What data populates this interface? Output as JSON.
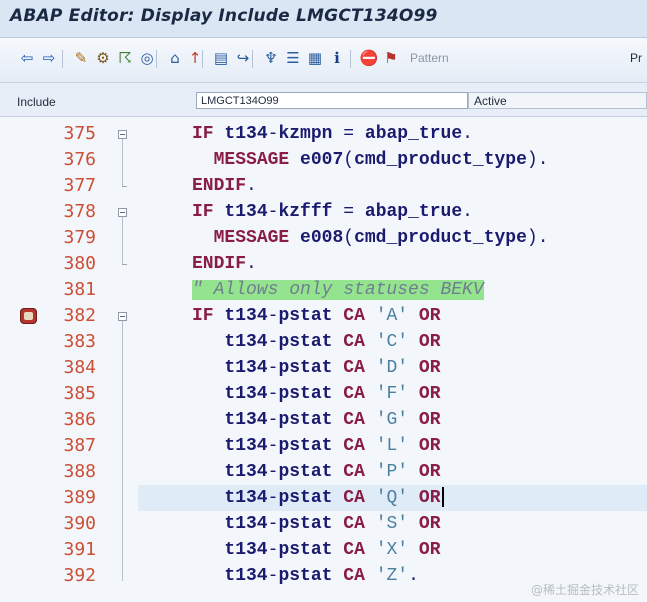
{
  "window": {
    "title": "ABAP Editor: Display Include LMGCT134O99"
  },
  "toolbar": {
    "buttons": [
      {
        "name": "back-arrow-icon",
        "glyph": "⇦",
        "color": "#1b58b7"
      },
      {
        "name": "forward-arrow-icon",
        "glyph": "⇨",
        "color": "#1b58b7"
      },
      {
        "name": "other-object-icon",
        "glyph": "✎",
        "color": "#a86e1f"
      },
      {
        "name": "toggle-display-change-icon",
        "glyph": "⚙",
        "color": "#7a5a1f"
      },
      {
        "name": "activate-icon",
        "glyph": "☈",
        "color": "#3d7f2f"
      },
      {
        "name": "where-used-icon",
        "glyph": "◎",
        "color": "#2b5c9e"
      },
      {
        "name": "object-list-icon",
        "glyph": "⌂",
        "color": "#2b5c9e"
      },
      {
        "name": "display-object-list-icon",
        "glyph": "↑",
        "color": "#c43d2b"
      },
      {
        "name": "navigation-window-icon",
        "glyph": "▤",
        "color": "#2b5c9e"
      },
      {
        "name": "enhance-icon",
        "glyph": "↪",
        "color": "#2b5c9e"
      },
      {
        "name": "hierarchy-icon",
        "glyph": "♆",
        "color": "#2b5c9e"
      },
      {
        "name": "tree-icon",
        "glyph": "☰",
        "color": "#2b5c9e"
      },
      {
        "name": "module-icon",
        "glyph": "▦",
        "color": "#2b5c9e"
      },
      {
        "name": "info-icon",
        "glyph": "ℹ",
        "color": "#1c3c8a"
      },
      {
        "name": "set-breakpoint-icon",
        "glyph": "⛔",
        "color": "#b8332b"
      },
      {
        "name": "session-breakpoint-icon",
        "glyph": "⚑",
        "color": "#b8332b"
      }
    ],
    "pattern_label": "Pattern",
    "pretty_label": "Pr"
  },
  "include_bar": {
    "label": "Include",
    "name_value": "LMGCT134O99",
    "status": "Active"
  },
  "editor": {
    "breakpoint_line": "382",
    "current_line": "389",
    "lines": [
      {
        "num": "375",
        "fold": "box",
        "html": "<span class=\"kw\">IF</span> <span class=\"ident\">t134</span><span class=\"op\">-</span><span class=\"ident\">kzmpn</span> <span class=\"op\">=</span> <span class=\"ident\">abap_true</span><span class=\"op\">.</span>"
      },
      {
        "num": "376",
        "fold": "line",
        "html": "  <span class=\"kw\">MESSAGE</span> <span class=\"ident\">e007</span><span class=\"op\">(</span><span class=\"ident\">cmd_product_type</span><span class=\"op\">).</span>"
      },
      {
        "num": "377",
        "fold": "tick",
        "html": "<span class=\"kw\">ENDIF</span><span class=\"op\">.</span>"
      },
      {
        "num": "378",
        "fold": "box",
        "html": "<span class=\"kw\">IF</span> <span class=\"ident\">t134</span><span class=\"op\">-</span><span class=\"ident\">kzfff</span> <span class=\"op\">=</span> <span class=\"ident\">abap_true</span><span class=\"op\">.</span>"
      },
      {
        "num": "379",
        "fold": "line",
        "html": "  <span class=\"kw\">MESSAGE</span> <span class=\"ident\">e008</span><span class=\"op\">(</span><span class=\"ident\">cmd_product_type</span><span class=\"op\">).</span>"
      },
      {
        "num": "380",
        "fold": "tick",
        "html": "<span class=\"kw\">ENDIF</span><span class=\"op\">.</span>"
      },
      {
        "num": "381",
        "fold": "none",
        "html": "<span class=\"comment\">\" Allows only statuses BEKV</span>"
      },
      {
        "num": "382",
        "fold": "box",
        "html": "<span class=\"kw\">IF</span> <span class=\"ident\">t134</span><span class=\"op\">-</span><span class=\"ident\">pstat</span> <span class=\"kw\">CA</span> <span class=\"str\">'A'</span> <span class=\"kw\">OR</span>"
      },
      {
        "num": "383",
        "fold": "line",
        "html": "   <span class=\"ident\">t134</span><span class=\"op\">-</span><span class=\"ident\">pstat</span> <span class=\"kw\">CA</span> <span class=\"str\">'C'</span> <span class=\"kw\">OR</span>"
      },
      {
        "num": "384",
        "fold": "line",
        "html": "   <span class=\"ident\">t134</span><span class=\"op\">-</span><span class=\"ident\">pstat</span> <span class=\"kw\">CA</span> <span class=\"str\">'D'</span> <span class=\"kw\">OR</span>"
      },
      {
        "num": "385",
        "fold": "line",
        "html": "   <span class=\"ident\">t134</span><span class=\"op\">-</span><span class=\"ident\">pstat</span> <span class=\"kw\">CA</span> <span class=\"str\">'F'</span> <span class=\"kw\">OR</span>"
      },
      {
        "num": "386",
        "fold": "line",
        "html": "   <span class=\"ident\">t134</span><span class=\"op\">-</span><span class=\"ident\">pstat</span> <span class=\"kw\">CA</span> <span class=\"str\">'G'</span> <span class=\"kw\">OR</span>"
      },
      {
        "num": "387",
        "fold": "line",
        "html": "   <span class=\"ident\">t134</span><span class=\"op\">-</span><span class=\"ident\">pstat</span> <span class=\"kw\">CA</span> <span class=\"str\">'L'</span> <span class=\"kw\">OR</span>"
      },
      {
        "num": "388",
        "fold": "line",
        "html": "   <span class=\"ident\">t134</span><span class=\"op\">-</span><span class=\"ident\">pstat</span> <span class=\"kw\">CA</span> <span class=\"str\">'P'</span> <span class=\"kw\">OR</span>"
      },
      {
        "num": "389",
        "fold": "line",
        "html": "   <span class=\"ident\">t134</span><span class=\"op\">-</span><span class=\"ident\">pstat</span> <span class=\"kw\">CA</span> <span class=\"str\">'Q'</span> <span class=\"kw\">OR</span><span class=\"cursor\"></span>"
      },
      {
        "num": "390",
        "fold": "line",
        "html": "   <span class=\"ident\">t134</span><span class=\"op\">-</span><span class=\"ident\">pstat</span> <span class=\"kw\">CA</span> <span class=\"str\">'S'</span> <span class=\"kw\">OR</span>"
      },
      {
        "num": "391",
        "fold": "line",
        "html": "   <span class=\"ident\">t134</span><span class=\"op\">-</span><span class=\"ident\">pstat</span> <span class=\"kw\">CA</span> <span class=\"str\">'X'</span> <span class=\"kw\">OR</span>"
      },
      {
        "num": "392",
        "fold": "line",
        "html": "   <span class=\"ident\">t134</span><span class=\"op\">-</span><span class=\"ident\">pstat</span> <span class=\"kw\">CA</span> <span class=\"str\">'Z'</span><span class=\"op\">.</span>"
      }
    ]
  },
  "watermark": "@稀土掘金技术社区"
}
